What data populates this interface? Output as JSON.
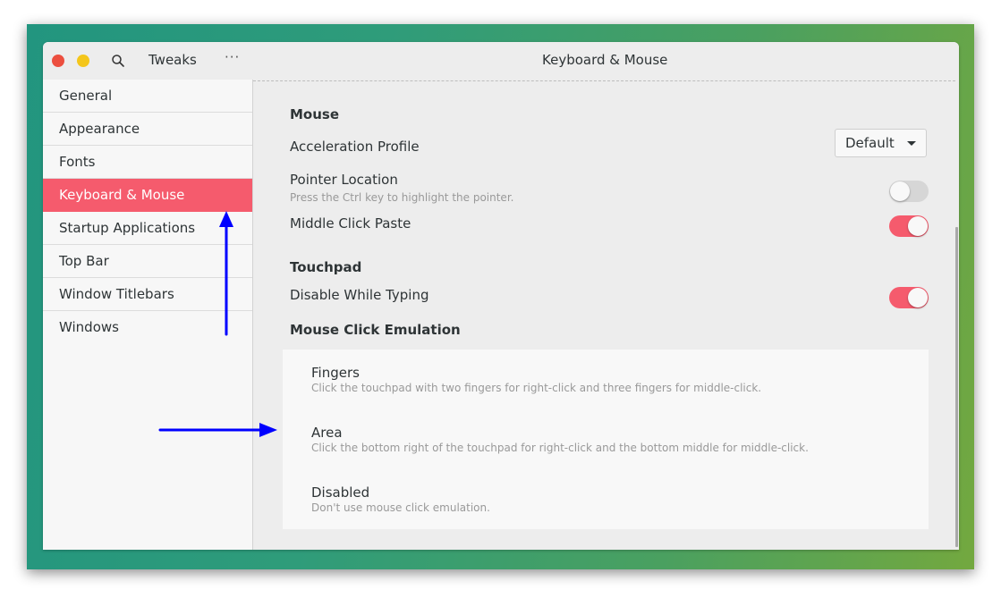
{
  "app": {
    "title": "Tweaks",
    "more_label": "···",
    "window_title": "Keyboard & Mouse"
  },
  "sidebar": {
    "items": [
      {
        "label": "General",
        "active": false
      },
      {
        "label": "Appearance",
        "active": false
      },
      {
        "label": "Fonts",
        "active": false
      },
      {
        "label": "Keyboard & Mouse",
        "active": true
      },
      {
        "label": "Startup Applications",
        "active": false
      },
      {
        "label": "Top Bar",
        "active": false
      },
      {
        "label": "Window Titlebars",
        "active": false
      },
      {
        "label": "Windows",
        "active": false
      }
    ]
  },
  "mouse": {
    "section_title": "Mouse",
    "acceleration_profile": {
      "label": "Acceleration Profile",
      "value": "Default"
    },
    "pointer_location": {
      "label": "Pointer Location",
      "description": "Press the Ctrl key to highlight the pointer.",
      "enabled": false
    },
    "middle_click_paste": {
      "label": "Middle Click Paste",
      "enabled": true
    }
  },
  "touchpad": {
    "section_title": "Touchpad",
    "disable_while_typing": {
      "label": "Disable While Typing",
      "enabled": true
    }
  },
  "click_emulation": {
    "section_title": "Mouse Click Emulation",
    "options": [
      {
        "title": "Fingers",
        "description": "Click the touchpad with two fingers for right-click and three fingers for middle-click."
      },
      {
        "title": "Area",
        "description": "Click the bottom right of the touchpad for right-click and the bottom middle for middle-click."
      },
      {
        "title": "Disabled",
        "description": "Don't use mouse click emulation."
      }
    ]
  },
  "colors": {
    "accent": "#f55b6d",
    "close": "#ec4f3f",
    "minimize": "#f4c61b",
    "annotation_arrow": "#0000ff"
  }
}
